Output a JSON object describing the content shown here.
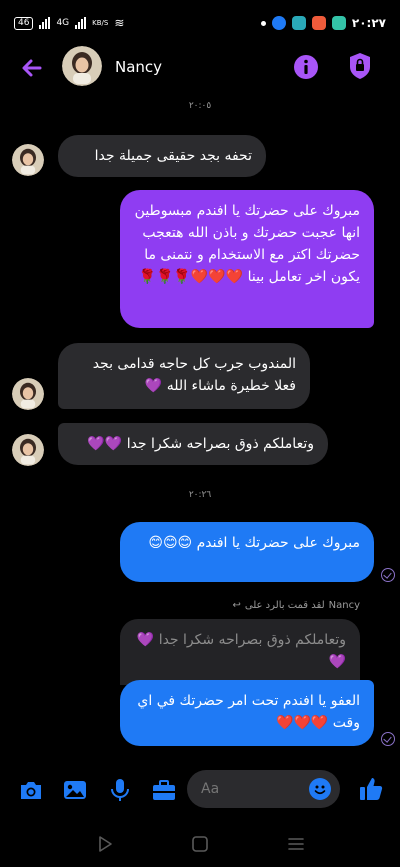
{
  "status_bar": {
    "left_chip": "46",
    "network": "4G",
    "speed": "KB/S",
    "time": "٢٠:٢٧",
    "app_colors": [
      "#1f7af5",
      "#2aa9b8",
      "#ef5b3b",
      "#34c3a8"
    ]
  },
  "header": {
    "contact_name": "Nancy",
    "back_icon": "arrow-left-icon",
    "info_icon": "info-icon",
    "shield_icon": "shield-icon"
  },
  "timestamps": {
    "first": "٢٠:٠٥",
    "second": "٢٠:٢٦"
  },
  "messages": [
    {
      "direction": "incoming",
      "text": "تحفه بجد حقيقى جميلة جدا"
    },
    {
      "direction": "outgoing",
      "text": "مبروك على حضرتك يا افندم مبسوطين انها عجبت حضرتك و باذن الله هتعجب حضرتك اكتر مع الاستخدام و نتمنى ما يكون اخر تعامل بينا",
      "emojis": "❤️❤️❤️🌹🌹🌹"
    },
    {
      "direction": "incoming",
      "text": "المندوب جرب كل حاجه قدامى بجد فعلا خطيرة ماشاء الله",
      "emojis": "💜"
    },
    {
      "direction": "incoming",
      "text": "وتعاملكم ذوق بصراحه شكرا جدا",
      "emojis": "💜💜"
    },
    {
      "direction": "outgoing",
      "text": "مبروك على حضرتك يا افندم",
      "emojis": "😊😊😊"
    },
    {
      "direction": "outgoing",
      "text": "العفو يا افندم تحت امر حضرتك في اي وقت",
      "emojis": "❤️❤️❤️"
    }
  ],
  "reply": {
    "name": "Nancy",
    "label": "لقد قمت بالرد على",
    "quoted_text": "وتعاملكم ذوق بصراحه شكرا جدا",
    "quoted_emojis": "💜💜"
  },
  "composer": {
    "placeholder": "Aa",
    "accent": "#1f7af5"
  },
  "colors": {
    "outgoing_purple": "#8f3df2",
    "outgoing_blue": "#1f7af5",
    "incoming": "#2b2b2e",
    "accent_purple": "#a855f7"
  }
}
